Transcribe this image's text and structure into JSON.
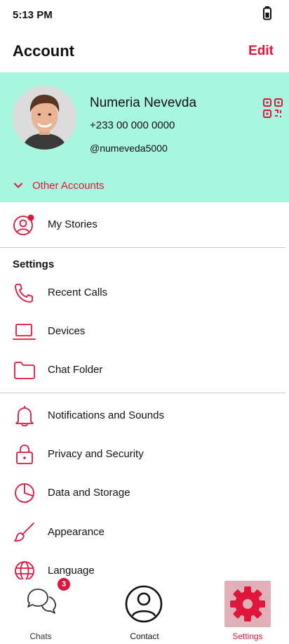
{
  "status": {
    "time": "5:13 PM"
  },
  "header": {
    "title": "Account",
    "edit_label": "Edit"
  },
  "profile": {
    "name": "Numeria Nevevda",
    "phone": "+233 00 000 0000",
    "handle": "@numeveda5000",
    "other_accounts_label": "Other Accounts"
  },
  "menu": {
    "my_stories": "My Stories",
    "settings_title": "Settings",
    "items": [
      {
        "label": "Recent Calls",
        "icon": "phone-icon"
      },
      {
        "label": "Devices",
        "icon": "laptop-icon"
      },
      {
        "label": "Chat Folder",
        "icon": "folder-icon"
      },
      {
        "label": "Notifications and Sounds",
        "icon": "bell-icon"
      },
      {
        "label": "Privacy and Security",
        "icon": "lock-icon"
      },
      {
        "label": "Data and Storage",
        "icon": "pie-chart-icon"
      },
      {
        "label": "Appearance",
        "icon": "brush-icon"
      },
      {
        "label": "Language",
        "icon": "globe-icon"
      }
    ]
  },
  "tabs": {
    "chats": "Chats",
    "chats_badge": "3",
    "contact": "Contact",
    "settings": "Settings"
  },
  "colors": {
    "accent": "#e0153b",
    "profile_bg": "#a8f5e0",
    "settings_tab_bg": "#e0b0b8"
  }
}
